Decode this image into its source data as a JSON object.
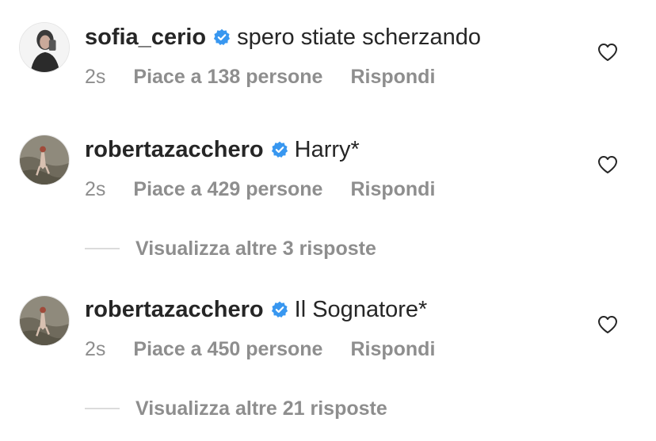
{
  "comments": [
    {
      "username": "sofia_cerio",
      "verified": true,
      "text": "spero stiate scherzando",
      "time": "2s",
      "likes": "Piace a 138 persone",
      "reply": "Rispondi",
      "avatar": "avatar-woman-selfie"
    },
    {
      "username": "robertazacchero",
      "verified": true,
      "text": "Harry*",
      "time": "2s",
      "likes": "Piace a 429 persone",
      "reply": "Rispondi",
      "avatar": "avatar-figure-on-rocks",
      "view_replies": "Visualizza altre 3 risposte"
    },
    {
      "username": "robertazacchero",
      "verified": true,
      "text": "Il Sognatore*",
      "time": "2s",
      "likes": "Piace a 450 persone",
      "reply": "Rispondi",
      "avatar": "avatar-figure-on-rocks",
      "view_replies": "Visualizza altre 21 risposte"
    }
  ],
  "colors": {
    "text_primary": "#262626",
    "text_secondary": "#8e8e8e",
    "verified_badge": "#3897f0",
    "divider": "#dbdbdb"
  },
  "icons": {
    "verified": "verified-badge-icon",
    "like": "heart-outline-icon"
  }
}
